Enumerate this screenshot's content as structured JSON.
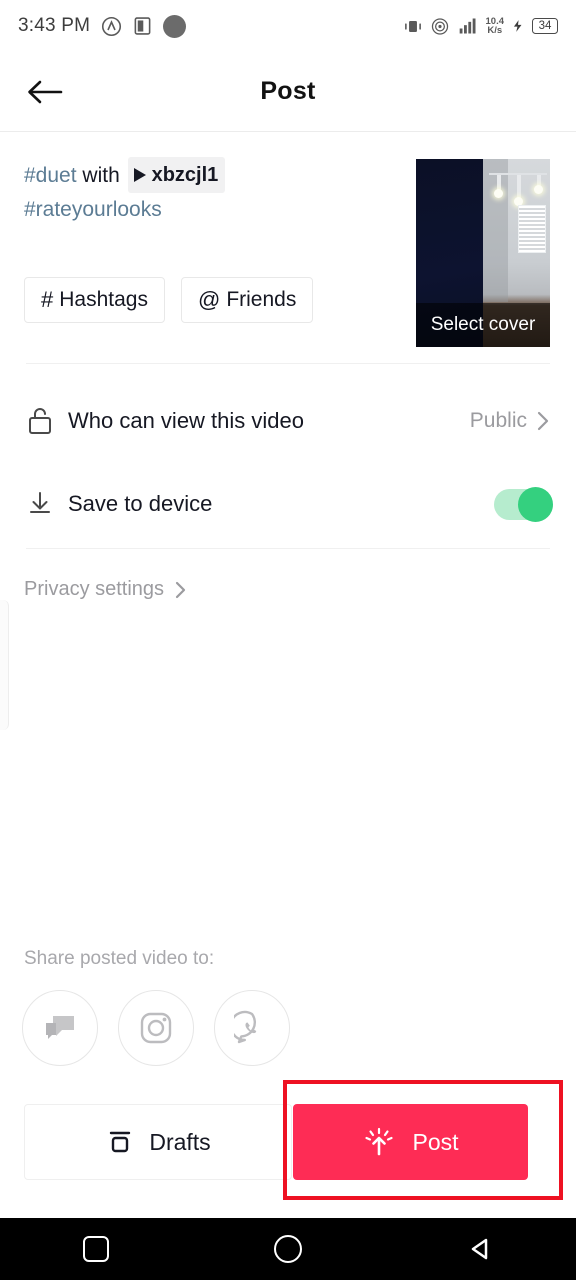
{
  "statusbar": {
    "time": "3:43 PM",
    "network_speed_value": "10.4",
    "network_speed_unit": "K/s",
    "battery_level": "34",
    "icons": [
      "location-icon",
      "app-badge-icon",
      "dot-icon",
      "vibrate-icon",
      "hotspot-icon",
      "signal-bars-icon",
      "charging-bolt-icon",
      "battery-icon"
    ]
  },
  "header": {
    "title": "Post",
    "back_icon": "arrow-left-icon"
  },
  "caption": {
    "hashtag_1": "#duet",
    "with_text": " with ",
    "mention_name": "xbzcjl1",
    "hashtag_2": "#rateyourlooks",
    "hashtag_color": "#5c7c94"
  },
  "tag_buttons": [
    {
      "symbol": "#",
      "label": "Hashtags",
      "name": "hashtags-button"
    },
    {
      "symbol": "@",
      "label": "Friends",
      "name": "friends-button"
    }
  ],
  "thumbnail": {
    "cover_label": "Select cover"
  },
  "settings": [
    {
      "icon": "unlock-icon",
      "label": "Who can view this video",
      "value": "Public",
      "control": "chevron"
    },
    {
      "icon": "download-icon",
      "label": "Save to device",
      "value": "on",
      "control": "toggle"
    }
  ],
  "privacy": {
    "label": "Privacy settings",
    "chevron_icon": "chevron-right-icon"
  },
  "share": {
    "title": "Share posted video to:",
    "targets": [
      {
        "name": "messages-share-icon",
        "label": "Messages"
      },
      {
        "name": "instagram-share-icon",
        "label": "Instagram"
      },
      {
        "name": "whatsapp-share-icon",
        "label": "WhatsApp"
      }
    ]
  },
  "bottom": {
    "drafts_label": "Drafts",
    "drafts_icon": "drafts-box-icon",
    "post_label": "Post",
    "post_icon": "upload-burst-icon",
    "post_color": "#fe2c55",
    "highlight_color": "#ee1122"
  },
  "navbar": {
    "recents": "square-recents-icon",
    "home": "circle-home-icon",
    "back": "triangle-back-icon"
  }
}
